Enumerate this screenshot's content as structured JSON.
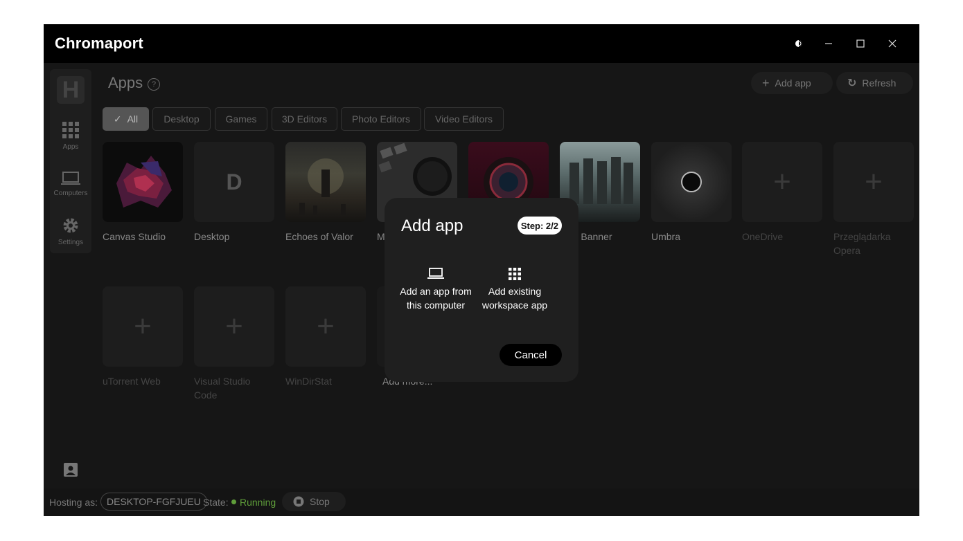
{
  "app": {
    "title": "Chromaport"
  },
  "titlebar": {
    "theme_icon": "brightness-icon",
    "minimize_icon": "minimize-icon",
    "maximize_icon": "maximize-icon",
    "close_icon": "close-icon"
  },
  "sidebar": {
    "logo_letter": "H",
    "items": [
      {
        "label": "Apps",
        "icon": "grid-icon"
      },
      {
        "label": "Computers",
        "icon": "laptop-icon"
      },
      {
        "label": "Settings",
        "icon": "gear-icon"
      }
    ]
  },
  "header": {
    "title": "Apps",
    "add_label": "Add app",
    "refresh_label": "Refresh"
  },
  "filters": [
    "All",
    "Desktop",
    "Games",
    "3D Editors",
    "Photo Editors",
    "Video Editors"
  ],
  "apps": [
    {
      "name": "Canvas Studio"
    },
    {
      "name": "Desktop",
      "letter": "D"
    },
    {
      "name": "Echoes of Valor"
    },
    {
      "name": "M"
    },
    {
      "name": ""
    },
    {
      "name": "Last Banner"
    },
    {
      "name": "Umbra"
    },
    {
      "name": "OneDrive"
    },
    {
      "name": "Przeglądarka Opera"
    },
    {
      "name": "uTorrent Web"
    },
    {
      "name": "Visual Studio Code"
    },
    {
      "name": "WinDirStat"
    },
    {
      "name": "Add more..."
    }
  ],
  "status": {
    "hosting_label": "Hosting as:",
    "host": "DESKTOP-FGFJUEU",
    "state_label": "State:",
    "state": "Running",
    "state_color": "#5f9e3a",
    "stop_label": "Stop"
  },
  "modal": {
    "title": "Add app",
    "step": "Step: 2/2",
    "option1": "Add an app from this computer",
    "option2": "Add existing workspace app",
    "cancel": "Cancel"
  }
}
